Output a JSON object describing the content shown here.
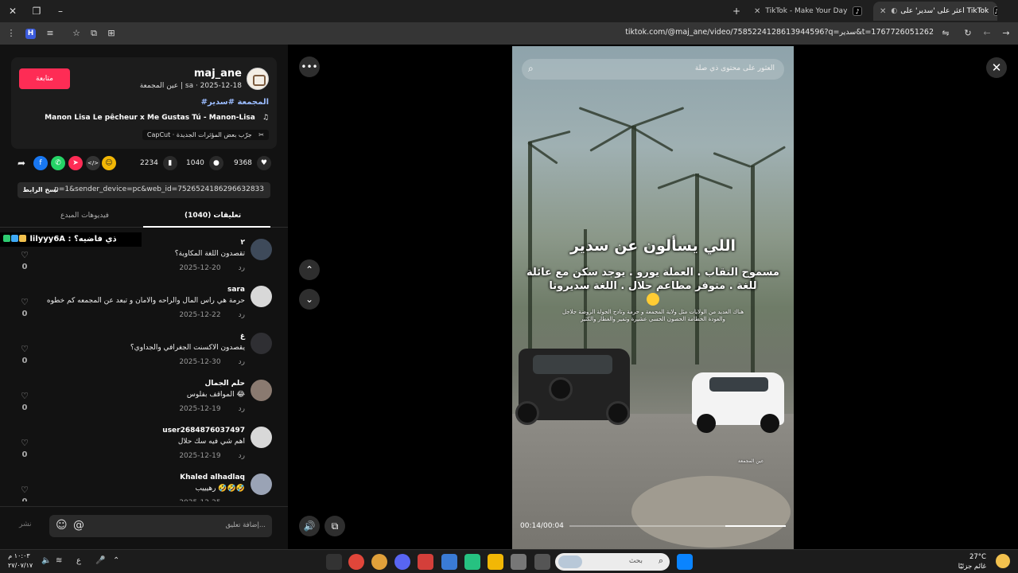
{
  "browser": {
    "tabs": [
      {
        "title": "اعثر على 'سدير' على TikTok",
        "active": true
      },
      {
        "title": "TikTok - Make Your Day",
        "active": false
      }
    ],
    "url": "tiktok.com/@maj_ane/video/7585224128613944596?q=سدير&t=1767726051262"
  },
  "post": {
    "follow_label": "متابعة",
    "username": "maj_ane",
    "subline": "عين المجمعة | sa · 2025-12-18",
    "hashtags": "#المجمعة #سدير",
    "music": "Manon Lisa Le pêcheur x Me Gustas Tú - Manon-Lisa",
    "capcut": "CapCut · جرّب بعض المؤثرات الجديدة",
    "likes": "9368",
    "comments_count": "1040",
    "saves": "2234",
    "link": "p=1&sender_device=pc&web_id=7526524186296632833",
    "copy_link_label": "نسخ الرابط"
  },
  "panel_tabs": {
    "comments": "تعليقات (1040)",
    "creator_videos": "فيديوهات المبدع"
  },
  "live_banner": "lilyyy6A : ذي فاضيه؟",
  "comments": [
    {
      "name": "٢",
      "text": "تقصدون اللغة المكاوية؟",
      "date": "2025-12-20",
      "reply": "رد",
      "likes": "0"
    },
    {
      "name": "sara",
      "text": "حرمة هي راس المال والراحه والامان و تبعد عن المجمعه كم خطوه",
      "date": "2025-12-22",
      "reply": "رد",
      "likes": "0"
    },
    {
      "name": "غ",
      "text": "يقصدون الاكسنت الجغرافي والجداوي؟",
      "date": "2025-12-30",
      "reply": "رد",
      "likes": "0"
    },
    {
      "name": "حلم الجمال",
      "text": "المواقف بفلوس 😂",
      "date": "2025-12-19",
      "reply": "رد",
      "likes": "0"
    },
    {
      "name": "user2684876037497",
      "text": "اهم شي فيه سك حلال",
      "date": "2025-12-19",
      "reply": "رد",
      "likes": "0"
    },
    {
      "name": "Khaled alhadlaq",
      "text": "رهيييب 🤣🤣🤣",
      "date": "2025-12-25",
      "reply": "رد",
      "likes": "0"
    }
  ],
  "compose": {
    "placeholder": "إضافة تعليق...",
    "post_label": "نشر"
  },
  "video": {
    "search_placeholder": "العثور على محتوى ذي صلة",
    "title": "اللي يسألون عن سدير",
    "subtitle": "مسموح النقاب . العملة يورو . يوجد سكن مع عائلة للغة . متوفر مطاعم حلال . اللغة سديروتا",
    "small_text": "هناك العديد من الولايات مثل ولاية المجمعة و حرمة وتادج الجولة الروضة جلاجل والعودة الخطامة الحصون الحسي عشيرة وتمير والغطار والكثير",
    "watermark": "عين المجمعة",
    "time": "00:14/00:04",
    "progress": 0.28
  },
  "taskbar": {
    "time": "١٠:٠٣ م",
    "date": "٢٧/٠٧/١٧",
    "lang": "ع",
    "search_placeholder": "بحث",
    "temperature": "27°C",
    "weather": "غائم جزئيًا"
  }
}
